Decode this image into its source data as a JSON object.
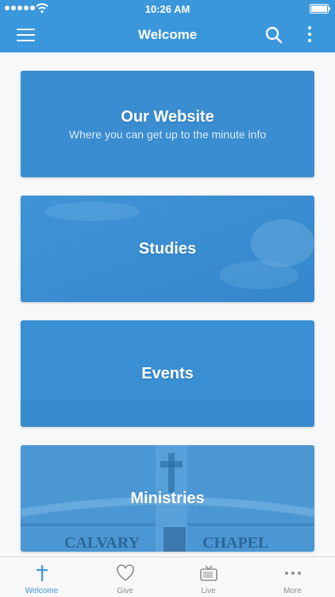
{
  "status_bar": {
    "time": "10:26 AM"
  },
  "nav": {
    "title": "Welcome"
  },
  "cards": [
    {
      "title": "Our Website",
      "subtitle": "Where you can get up to the minute info"
    },
    {
      "title": "Studies"
    },
    {
      "title": "Events"
    },
    {
      "title": "Ministries",
      "sign_text": "CALVARY CHAPEL"
    }
  ],
  "tabs": [
    {
      "label": "Welcome",
      "icon": "cross-icon",
      "active": true
    },
    {
      "label": "Give",
      "icon": "heart-icon"
    },
    {
      "label": "Live",
      "icon": "tv-icon"
    },
    {
      "label": "More",
      "icon": "more-dots-icon"
    }
  ],
  "colors": {
    "accent": "#3b97db",
    "card_blue": "#3a8fd1",
    "tab_inactive": "#8e8e93"
  }
}
